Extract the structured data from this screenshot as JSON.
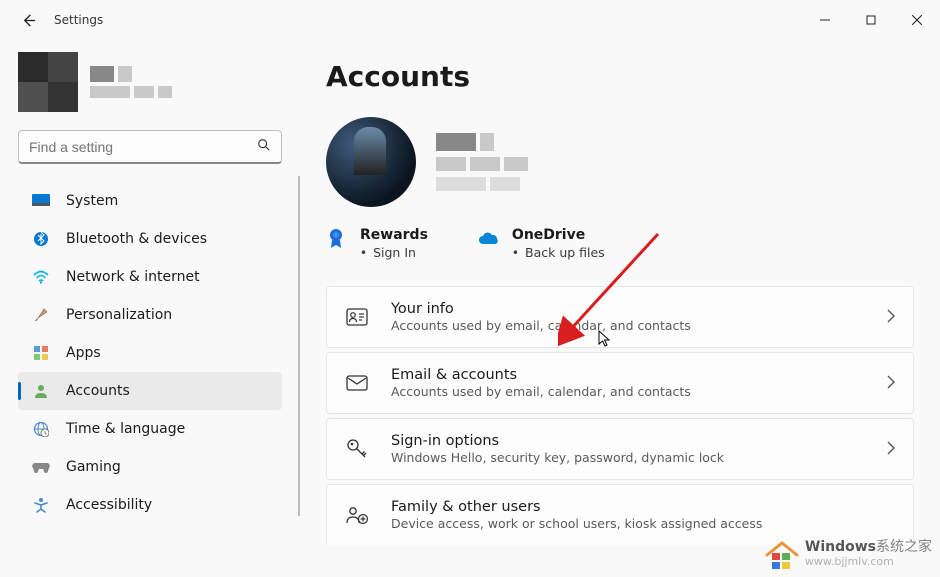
{
  "app": {
    "title": "Settings"
  },
  "search": {
    "placeholder": "Find a setting"
  },
  "nav": {
    "items": [
      {
        "label": "System"
      },
      {
        "label": "Bluetooth & devices"
      },
      {
        "label": "Network & internet"
      },
      {
        "label": "Personalization"
      },
      {
        "label": "Apps"
      },
      {
        "label": "Accounts"
      },
      {
        "label": "Time & language"
      },
      {
        "label": "Gaming"
      },
      {
        "label": "Accessibility"
      }
    ],
    "selected_index": 5
  },
  "page": {
    "title": "Accounts",
    "tiles": {
      "rewards": {
        "title": "Rewards",
        "sub": "Sign In"
      },
      "onedrive": {
        "title": "OneDrive",
        "sub": "Back up files"
      }
    },
    "cards": [
      {
        "title": "Your info",
        "sub": "Accounts used by email, calendar, and contacts",
        "icon": "person-card-icon"
      },
      {
        "title": "Email & accounts",
        "sub": "Accounts used by email, calendar, and contacts",
        "icon": "mail-icon"
      },
      {
        "title": "Sign-in options",
        "sub": "Windows Hello, security key, password, dynamic lock",
        "icon": "key-icon"
      },
      {
        "title": "Family & other users",
        "sub": "Device access, work or school users, kiosk assigned access",
        "icon": "people-add-icon"
      }
    ]
  },
  "watermark": {
    "line1_brand": "Windows",
    "line1_rest": "系统之家",
    "line2": "www.bjjmlv.com"
  }
}
